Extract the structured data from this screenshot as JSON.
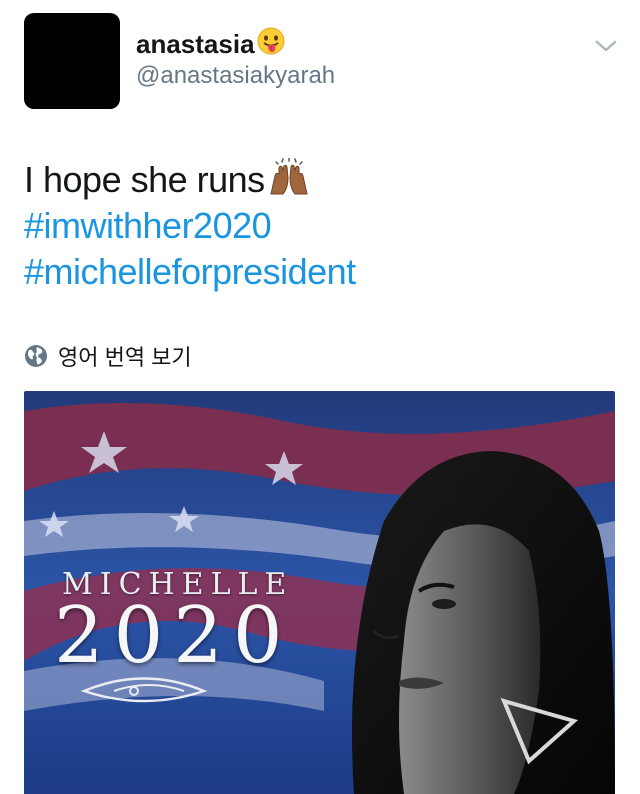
{
  "user": {
    "display_name": "anastasia",
    "handle": "@anastasiakyarah",
    "name_emoji": "face-with-tongue"
  },
  "tweet": {
    "text": "I hope she runs",
    "text_emoji": "raising-hands-medium-dark-skin",
    "hashtags": [
      "#imwithher2020",
      "#michelleforpresident"
    ]
  },
  "translate": {
    "label": "영어 번역 보기",
    "icon": "globe-icon"
  },
  "media": {
    "title": "MICHELLE",
    "year": "2020"
  },
  "colors": {
    "hashtag": "#1b95e0",
    "handle": "#657786",
    "text": "#14171a"
  }
}
